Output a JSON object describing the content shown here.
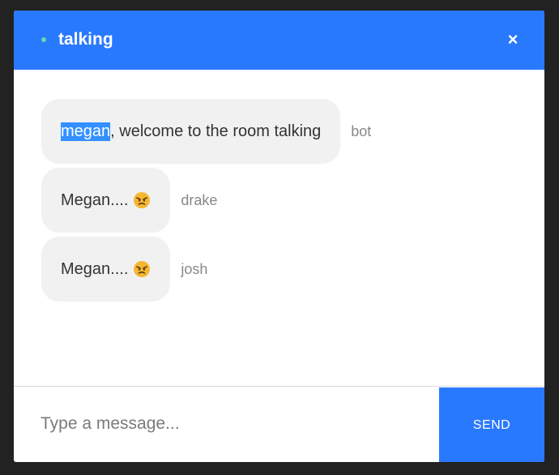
{
  "header": {
    "title": "talking",
    "close_label": "×",
    "status_color": "#5fe0a6",
    "accent_color": "#2979ff"
  },
  "messages": [
    {
      "highlight": "megan",
      "text": ", welcome to the room talking",
      "sender": "bot"
    },
    {
      "text": "Megan....",
      "emoji": "angry-face",
      "sender": "drake"
    },
    {
      "text": "Megan....",
      "emoji": "angry-face",
      "sender": "josh"
    }
  ],
  "composer": {
    "placeholder": "Type a message...",
    "value": "",
    "send_label": "SEND"
  }
}
